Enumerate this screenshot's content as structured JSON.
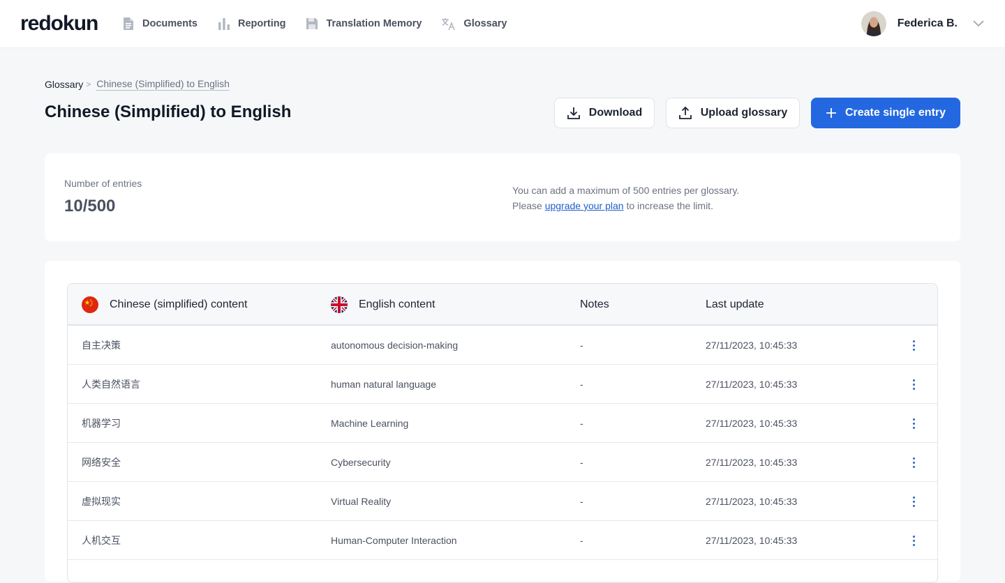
{
  "app": {
    "logo": "redokun"
  },
  "nav": {
    "items": [
      {
        "label": "Documents",
        "icon": "document-icon"
      },
      {
        "label": "Reporting",
        "icon": "bar-chart-icon"
      },
      {
        "label": "Translation Memory",
        "icon": "memory-icon"
      },
      {
        "label": "Glossary",
        "icon": "translate-icon"
      }
    ]
  },
  "user": {
    "name": "Federica B."
  },
  "breadcrumb": {
    "root": "Glossary",
    "current": "Chinese (Simplified) to English"
  },
  "page": {
    "title": "Chinese (Simplified) to English"
  },
  "actions": {
    "download": "Download",
    "upload": "Upload glossary",
    "create": "Create single entry"
  },
  "stats": {
    "label": "Number of entries",
    "value": "10/500",
    "info_line1": "You can add a maximum of 500 entries per glossary.",
    "info_prefix": "Please",
    "info_link": "upgrade your plan",
    "info_suffix": "to increase the limit."
  },
  "table": {
    "columns": {
      "source": "Chinese (simplified) content",
      "target": "English content",
      "notes": "Notes",
      "updated": "Last update"
    },
    "rows": [
      {
        "source": "自主决策",
        "target": "autonomous decision-making",
        "notes": "-",
        "updated": "27/11/2023, 10:45:33"
      },
      {
        "source": "人类自然语言",
        "target": "human natural language",
        "notes": "-",
        "updated": "27/11/2023, 10:45:33"
      },
      {
        "source": "机器学习",
        "target": "Machine Learning",
        "notes": "-",
        "updated": "27/11/2023, 10:45:33"
      },
      {
        "source": "网络安全",
        "target": "Cybersecurity",
        "notes": "-",
        "updated": "27/11/2023, 10:45:33"
      },
      {
        "source": "虚拟现实",
        "target": "Virtual Reality",
        "notes": "-",
        "updated": "27/11/2023, 10:45:33"
      },
      {
        "source": "人机交互",
        "target": "Human-Computer Interaction",
        "notes": "-",
        "updated": "27/11/2023, 10:45:33"
      },
      {
        "source": "",
        "target": "",
        "notes": "",
        "updated": ""
      }
    ]
  },
  "colors": {
    "primary": "#2368e0",
    "link": "#1f5fc9",
    "background": "#f6f7f9"
  }
}
